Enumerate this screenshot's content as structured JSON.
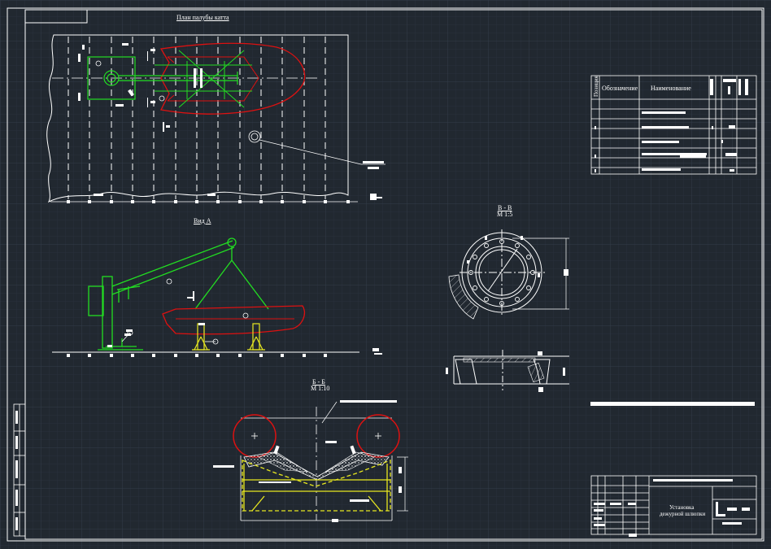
{
  "drawing": {
    "plan_title": "План палубы катта",
    "view_a_title": "Вид А",
    "section_vv": {
      "title": "В - В",
      "scale": "М 1:5"
    },
    "section_bb": {
      "title": "Б - Б",
      "scale": "М 1:10"
    },
    "spec_table": {
      "col_position": "Позиция",
      "col_designation": "Обозначение",
      "col_name": "Наименование"
    },
    "title_block": {
      "title_line1": "Установка",
      "title_line2": "дежурной шлюпки"
    }
  },
  "colors": {
    "background": "#212830",
    "grid_minor": "#2b3440",
    "grid_major": "#35404e",
    "line": "#ffffff",
    "crane": "#22dd22",
    "hull": "#dd1111",
    "cradle": "#e8e820"
  },
  "callouts": [
    "1",
    "2",
    "3",
    "4",
    "5"
  ]
}
